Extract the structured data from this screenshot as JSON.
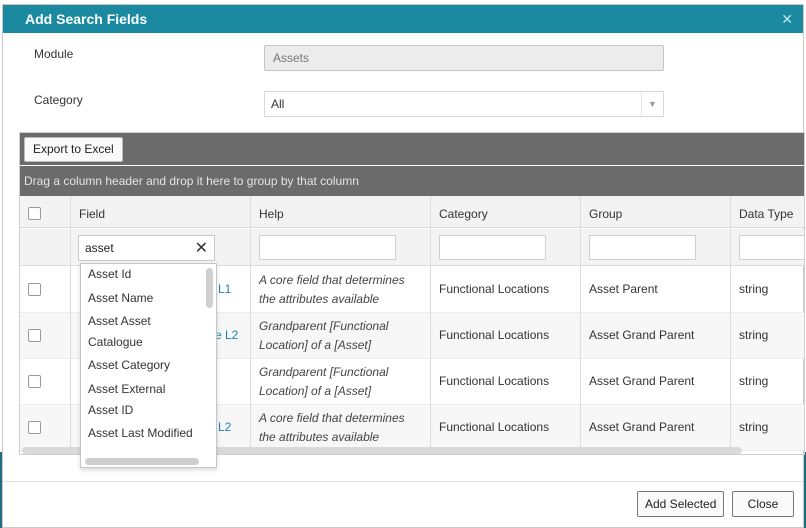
{
  "dialog": {
    "title": "Add Search Fields",
    "close_glyph": "✕"
  },
  "form": {
    "module_label": "Module",
    "module_value": "Assets",
    "category_label": "Category",
    "category_value": "All"
  },
  "grid": {
    "export_label": "Export to Excel",
    "group_hint": "Drag a column header and drop it here to group by that column",
    "columns": [
      "Field",
      "Help",
      "Category",
      "Group",
      "Data Type"
    ],
    "field_filter_value": "asset",
    "rows": [
      {
        "field": "L1",
        "help": [
          "A core field that determines",
          "the attributes available"
        ],
        "category": "Functional Locations",
        "group": "Asset Parent",
        "type": "string"
      },
      {
        "field": "e L2",
        "help": [
          "Grandparent [Functional",
          "Location] of a [Asset]"
        ],
        "category": "Functional Locations",
        "group": "Asset Grand Parent",
        "type": "string"
      },
      {
        "field": "",
        "help": [
          "Grandparent [Functional",
          "Location] of a [Asset]"
        ],
        "category": "Functional Locations",
        "group": "Asset Grand Parent",
        "type": "string"
      },
      {
        "field": "L2",
        "help": [
          "A core field that determines",
          "the attributes available"
        ],
        "category": "Functional Locations",
        "group": "Asset Grand Parent",
        "type": "string"
      }
    ]
  },
  "autocomplete": {
    "items": [
      "Asset Id",
      "Asset Name",
      "Asset Asset Catalogue",
      "Asset Category",
      "Asset External",
      "Asset ID",
      "Asset Last Modified"
    ]
  },
  "footer": {
    "add_label": "Add Selected",
    "close_label": "Close"
  },
  "colors": {
    "title_bar": "#1b8aa0",
    "toolbar": "#6b6b6b",
    "link": "#1a82b5"
  }
}
